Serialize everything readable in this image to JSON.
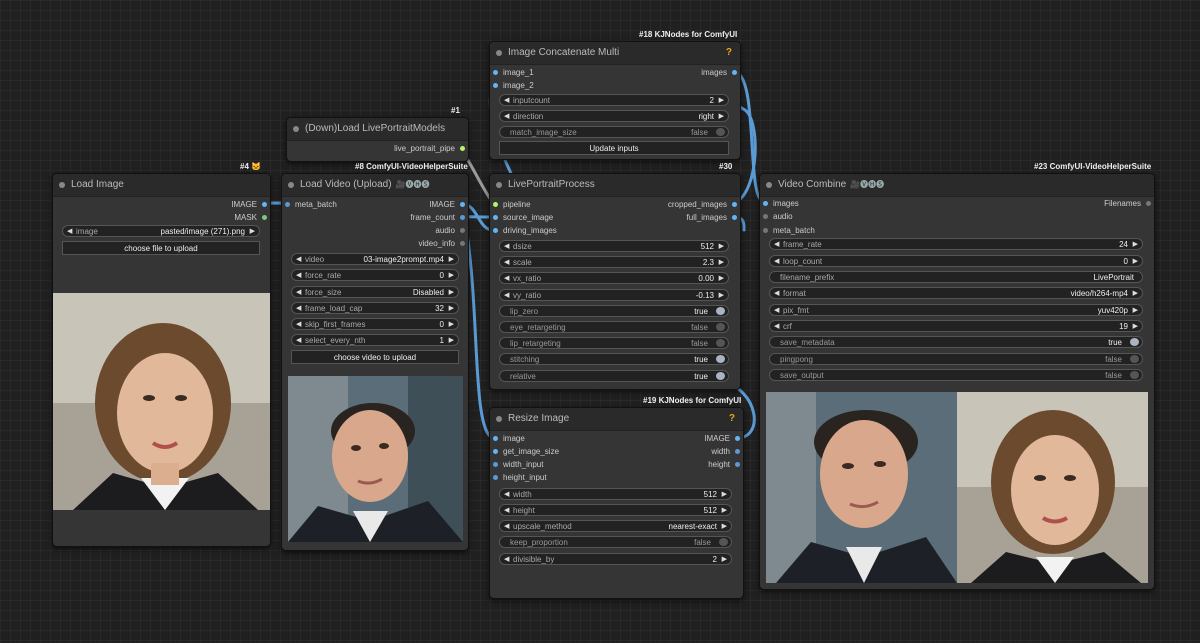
{
  "nodes": {
    "load_image": {
      "badge": "#4",
      "badge_emoji": "🐱",
      "title": "Load Image",
      "outputs": [
        "IMAGE",
        "MASK"
      ],
      "image_label": "image",
      "image_value": "pasted/image (271).png",
      "upload_button": "choose file to upload"
    },
    "load_models": {
      "badge": "#1",
      "title": "(Down)Load LivePortraitModels",
      "output": "live_portrait_pipe"
    },
    "load_video": {
      "badge": "#8 ComfyUI-VideoHelperSuite",
      "title": "Load Video (Upload)",
      "title_icons": "🎥🅥🅗🅢",
      "input": "meta_batch",
      "outputs": [
        "IMAGE",
        "frame_count",
        "audio",
        "video_info"
      ],
      "widgets": [
        {
          "label": "video",
          "value": "03-image2prompt.mp4"
        },
        {
          "label": "force_rate",
          "value": "0"
        },
        {
          "label": "force_size",
          "value": "Disabled"
        },
        {
          "label": "frame_load_cap",
          "value": "32"
        },
        {
          "label": "skip_first_frames",
          "value": "0"
        },
        {
          "label": "select_every_nth",
          "value": "1"
        }
      ],
      "upload_button": "choose video to upload"
    },
    "concat": {
      "badge": "#18 KJNodes for ComfyUI",
      "title": "Image Concatenate Multi",
      "help": "?",
      "inputs": [
        "image_1",
        "image_2"
      ],
      "output": "images",
      "widgets": [
        {
          "label": "inputcount",
          "value": "2"
        },
        {
          "label": "direction",
          "value": "right"
        }
      ],
      "toggle": {
        "label": "match_image_size",
        "value": "false"
      },
      "button": "Update inputs"
    },
    "liveportrait": {
      "badge": "#30",
      "title": "LivePortraitProcess",
      "inputs": [
        "pipeline",
        "source_image",
        "driving_images"
      ],
      "outputs": [
        "cropped_images",
        "full_images"
      ],
      "widgets": [
        {
          "label": "dsize",
          "value": "512"
        },
        {
          "label": "scale",
          "value": "2.3"
        },
        {
          "label": "vx_ratio",
          "value": "0.00"
        },
        {
          "label": "vy_ratio",
          "value": "-0.13"
        }
      ],
      "toggles": [
        {
          "label": "lip_zero",
          "value": "true"
        },
        {
          "label": "eye_retargeting",
          "value": "false"
        },
        {
          "label": "lip_retargeting",
          "value": "false"
        },
        {
          "label": "stitching",
          "value": "true"
        },
        {
          "label": "relative",
          "value": "true"
        }
      ]
    },
    "resize": {
      "badge": "#19 KJNodes for ComfyUI",
      "title": "Resize Image",
      "help": "?",
      "inputs": [
        "image",
        "get_image_size",
        "width_input",
        "height_input"
      ],
      "outputs": [
        "IMAGE",
        "width",
        "height"
      ],
      "widgets": [
        {
          "label": "width",
          "value": "512"
        },
        {
          "label": "height",
          "value": "512"
        },
        {
          "label": "upscale_method",
          "value": "nearest-exact"
        }
      ],
      "toggle": {
        "label": "keep_proportion",
        "value": "false"
      },
      "divisible": {
        "label": "divisible_by",
        "value": "2"
      }
    },
    "video_combine": {
      "badge": "#23 ComfyUI-VideoHelperSuite",
      "title": "Video Combine",
      "title_icons": "🎥🅥🅗🅢",
      "inputs": [
        "images",
        "audio",
        "meta_batch"
      ],
      "output": "Filenames",
      "widgets": [
        {
          "label": "frame_rate",
          "value": "24"
        },
        {
          "label": "loop_count",
          "value": "0"
        }
      ],
      "prefix": {
        "label": "filename_prefix",
        "value": "LivePortrait"
      },
      "widgets2": [
        {
          "label": "format",
          "value": "video/h264-mp4"
        },
        {
          "label": "pix_fmt",
          "value": "yuv420p"
        },
        {
          "label": "crf",
          "value": "19"
        }
      ],
      "toggles": [
        {
          "label": "save_metadata",
          "value": "true"
        },
        {
          "label": "pingpong",
          "value": "false"
        },
        {
          "label": "save_output",
          "value": "false"
        }
      ]
    }
  },
  "colors": {
    "canvas": "#202020",
    "node": "#353535",
    "title": "#2a2a2a",
    "image_pin": "#64b5f6",
    "mask_pin": "#81c784",
    "wire": "#5b9bd5",
    "help": "#e8a71b"
  }
}
